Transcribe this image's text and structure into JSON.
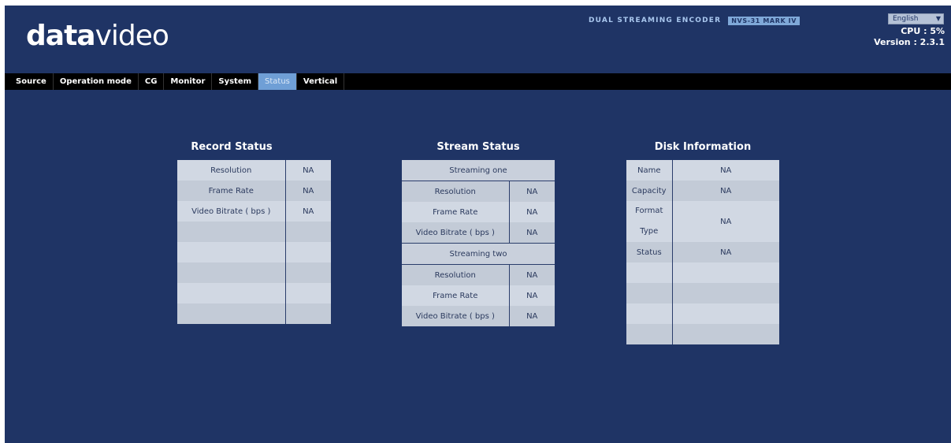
{
  "header": {
    "logo_bold": "data",
    "logo_thin": "video",
    "product_name": "DUAL STREAMING ENCODER",
    "model": "NVS-31 MARK IV",
    "language": "English",
    "cpu": "CPU : 5%",
    "version": "Version : 2.3.1"
  },
  "nav": {
    "tabs": [
      {
        "label": "Source"
      },
      {
        "label": "Operation mode"
      },
      {
        "label": "CG"
      },
      {
        "label": "Monitor"
      },
      {
        "label": "System"
      },
      {
        "label": "Status",
        "active": true
      },
      {
        "label": "Vertical"
      }
    ]
  },
  "record": {
    "title": "Record Status",
    "rows": [
      {
        "label": "Resolution",
        "value": "NA"
      },
      {
        "label": "Frame Rate",
        "value": "NA"
      },
      {
        "label": "Video Bitrate ( bps )",
        "value": "NA"
      }
    ]
  },
  "stream": {
    "title": "Stream Status",
    "one": {
      "heading": "Streaming one",
      "rows": [
        {
          "label": "Resolution",
          "value": "NA"
        },
        {
          "label": "Frame Rate",
          "value": "NA"
        },
        {
          "label": "Video Bitrate ( bps )",
          "value": "NA"
        }
      ]
    },
    "two": {
      "heading": "Streaming two",
      "rows": [
        {
          "label": "Resolution",
          "value": "NA"
        },
        {
          "label": "Frame Rate",
          "value": "NA"
        },
        {
          "label": "Video Bitrate ( bps )",
          "value": "NA"
        }
      ]
    }
  },
  "disk": {
    "title": "Disk Information",
    "name_label": "Name",
    "name_value": "NA",
    "capacity_label": "Capacity",
    "capacity_value": "NA",
    "format_label": "Format",
    "type_label": "Type",
    "format_value": "NA",
    "status_label": "Status",
    "status_value": "NA"
  },
  "colors": {
    "background": "#1f3465",
    "active_tab": "#6f9fd6",
    "table_light": "#d1d8e3",
    "table_dark": "#c3cbd7"
  }
}
